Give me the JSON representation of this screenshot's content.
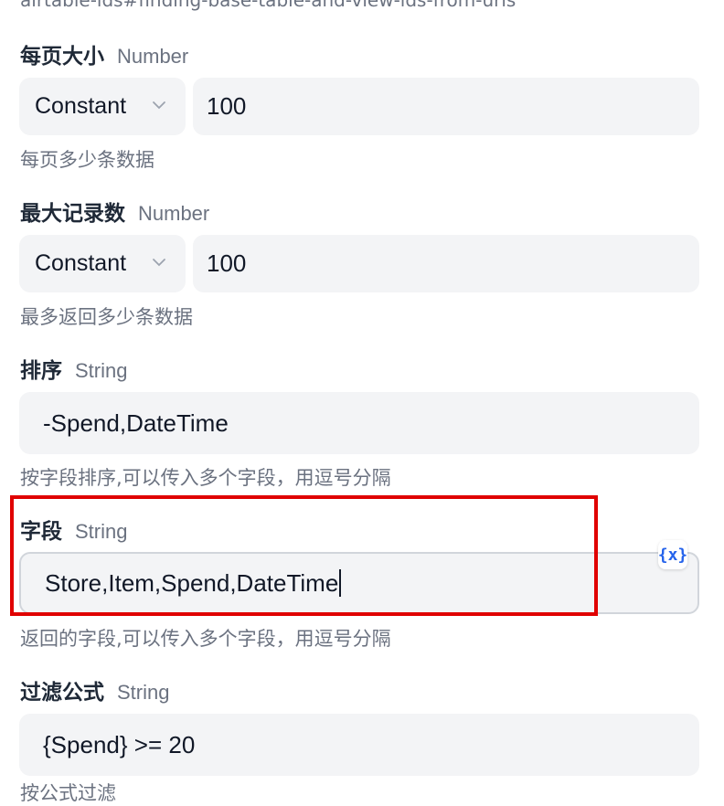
{
  "top_help_text": "airtable-ids#finding-base-table-and-view-ids-from-urls",
  "fields": {
    "page_size": {
      "label": "每页大小",
      "type": "Number",
      "mode": "Constant",
      "value": "100",
      "help": "每页多少条数据"
    },
    "max_records": {
      "label": "最大记录数",
      "type": "Number",
      "mode": "Constant",
      "value": "100",
      "help": "最多返回多少条数据"
    },
    "sort": {
      "label": "排序",
      "type": "String",
      "value": "-Spend,DateTime",
      "help": "按字段排序,可以传入多个字段，用逗号分隔"
    },
    "fields_param": {
      "label": "字段",
      "type": "String",
      "value": "Store,Item,Spend,DateTime",
      "help": "返回的字段,可以传入多个字段，用逗号分隔"
    },
    "filter_formula": {
      "label": "过滤公式",
      "type": "String",
      "value": "{Spend} >= 20",
      "help": "按公式过滤"
    }
  },
  "variable_button_label": "{x}",
  "colors": {
    "highlight": "#e00000",
    "variable_icon": "#2563eb",
    "input_bg": "#f3f4f6"
  }
}
